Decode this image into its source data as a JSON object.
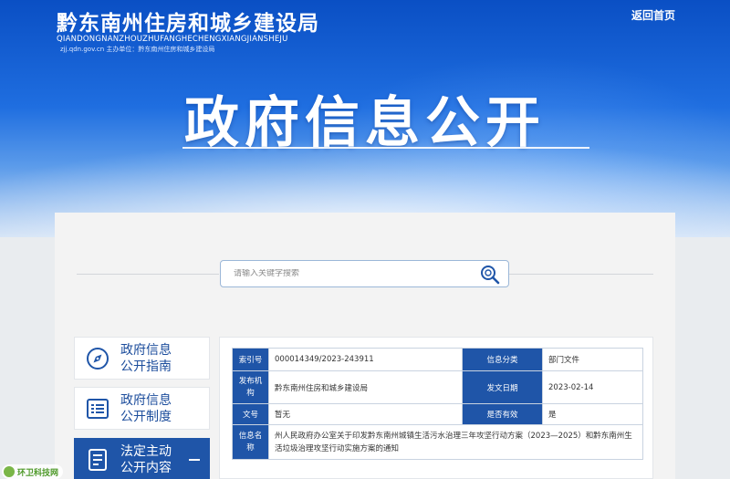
{
  "header": {
    "site_title": "黔东南州住房和城乡建设局",
    "pinyin": "QIANDONGNANZHOUZHUFANGHECHENGXIANGJIANSHEJU",
    "sub_info": "zjj.qdn.gov.cn    主办单位：黔东南州住房和城乡建设局",
    "return_home": "返回首页"
  },
  "hero": {
    "title": "政府信息公开"
  },
  "search": {
    "placeholder": "请输入关键字搜索"
  },
  "sidebar": {
    "items": [
      {
        "line1": "政府信息",
        "line2": "公开指南",
        "icon": "compass-icon"
      },
      {
        "line1": "政府信息",
        "line2": "公开制度",
        "icon": "list-icon"
      },
      {
        "line1": "法定主动",
        "line2": "公开内容",
        "icon": "document-icon",
        "active": true
      }
    ]
  },
  "info_table": {
    "index_no_label": "索引号",
    "index_no": "000014349/2023-243911",
    "category_label": "信息分类",
    "category": "部门文件",
    "issuer_label": "发布机构",
    "issuer": "黔东南州住房和城乡建设局",
    "date_label": "发文日期",
    "date": "2023-02-14",
    "doc_no_label": "文号",
    "doc_no": "暂无",
    "valid_label": "是否有效",
    "valid": "是",
    "name_label": "信息名称",
    "name": "州人民政府办公室关于印发黔东南州城镇生活污水治理三年攻坚行动方案（2023—2025）和黔东南州生活垃圾治理攻坚行动实施方案的通知"
  },
  "watermark": {
    "text": "环卫科技网"
  },
  "colors": {
    "primary": "#1f55a8",
    "banner": "#0a4fc4"
  }
}
